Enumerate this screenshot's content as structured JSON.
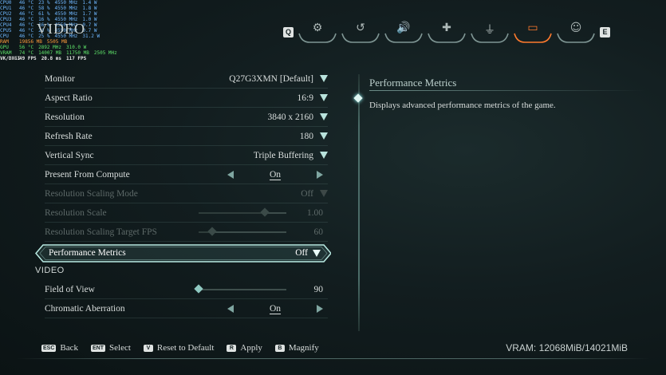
{
  "overlay": {
    "rows": [
      {
        "l": "CPU0",
        "a": "46 °C",
        "b": "23 %",
        "c": "4550 MHz",
        "d": "1.4 W",
        "cls": "cpu"
      },
      {
        "l": "CPU1",
        "a": "46 °C",
        "b": "58 %",
        "c": "4550 MHz",
        "d": "1.8 W",
        "cls": "cpu"
      },
      {
        "l": "CPU2",
        "a": "46 °C",
        "b": "61 %",
        "c": "4550 MHz",
        "d": "1.7 W",
        "cls": "cpu"
      },
      {
        "l": "CPU3",
        "a": "46 °C",
        "b": "16 %",
        "c": "4550 MHz",
        "d": "1.0 W",
        "cls": "cpu"
      },
      {
        "l": "CPU4",
        "a": "46 °C",
        "b": "16 %",
        "c": "4550 MHz",
        "d": "0.7 W",
        "cls": "cpu"
      },
      {
        "l": "CPU5",
        "a": "46 °C",
        "b": "24 %",
        "c": "4550 MHz",
        "d": "0.7 W",
        "cls": "cpu"
      },
      {
        "l": "CPU",
        "a": "46 °C",
        "b": "25 %",
        "c": "4550 MHz",
        "d": "31.2 W",
        "cls": "cpu"
      },
      {
        "l": "RAM",
        "a": "19856 MB",
        "b": "5505 MB",
        "c": "",
        "d": "",
        "cls": "ram"
      },
      {
        "l": "GPU",
        "a": "56 °C",
        "b": "2892 MHz",
        "c": "310.0 W",
        "d": "",
        "cls": "gpu"
      },
      {
        "l": "VRAM",
        "a": "74 °C",
        "b": "14007 MB",
        "c": "11750 MB",
        "d": "2505 MHz",
        "cls": "gpu"
      },
      {
        "l": "VK/DXGI",
        "a": "49 FPS",
        "b": "20.8 ms",
        "c": "117 FPS",
        "d": "",
        "cls": "bold"
      }
    ]
  },
  "page_title": "VIDEO",
  "top_tabs": {
    "left_key": "Q",
    "right_key": "E",
    "tabs": [
      {
        "name": "tab-gameplay",
        "icon": "gears-icon",
        "glyph": "⚙"
      },
      {
        "name": "tab-controls",
        "icon": "dragon-icon",
        "glyph": "↺"
      },
      {
        "name": "tab-audio",
        "icon": "speaker-icon",
        "glyph": "🔊"
      },
      {
        "name": "tab-gamepad",
        "icon": "dpad-icon",
        "glyph": "✚"
      },
      {
        "name": "tab-input",
        "icon": "joystick-icon",
        "glyph": "⏚"
      },
      {
        "name": "tab-video",
        "icon": "monitor-icon",
        "glyph": "▭"
      },
      {
        "name": "tab-accessibility",
        "icon": "accessibility-icon",
        "glyph": "☺"
      }
    ]
  },
  "settings": {
    "monitor": {
      "label": "Monitor",
      "value": "Q27G3XMN [Default]"
    },
    "aspect_ratio": {
      "label": "Aspect Ratio",
      "value": "16:9"
    },
    "resolution": {
      "label": "Resolution",
      "value": "3840 x 2160"
    },
    "refresh_rate": {
      "label": "Refresh Rate",
      "value": "180"
    },
    "vertical_sync": {
      "label": "Vertical Sync",
      "value": "Triple Buffering"
    },
    "present_from_compute": {
      "label": "Present From Compute",
      "value": "On"
    },
    "resolution_scaling_mode": {
      "label": "Resolution Scaling Mode",
      "value": "Off"
    },
    "resolution_scale": {
      "label": "Resolution Scale",
      "value": "1.00",
      "level": 0.75
    },
    "resolution_scaling_target_fps": {
      "label": "Resolution Scaling Target FPS",
      "value": "60",
      "level": 0.15
    },
    "performance_metrics": {
      "label": "Performance Metrics",
      "value": "Off"
    },
    "section_video": "VIDEO",
    "field_of_view": {
      "label": "Field of View",
      "value": "90",
      "level": 0.0
    },
    "chromatic_aberration": {
      "label": "Chromatic Aberration",
      "value": "On"
    }
  },
  "detail": {
    "title": "Performance Metrics",
    "description": "Displays advanced performance metrics of the game."
  },
  "footer": {
    "back": {
      "key": "ESC",
      "label": "Back"
    },
    "select": {
      "key": "ENT",
      "label": "Select"
    },
    "reset": {
      "key": "V",
      "label": "Reset to Default"
    },
    "apply": {
      "key": "R",
      "label": "Apply"
    },
    "magnify": {
      "key": "B",
      "label": "Magnify"
    },
    "vram": "VRAM: 12068MiB/14021MiB"
  },
  "colors": {
    "accent": "#ff7a2d",
    "teal": "#b9e3dc"
  }
}
